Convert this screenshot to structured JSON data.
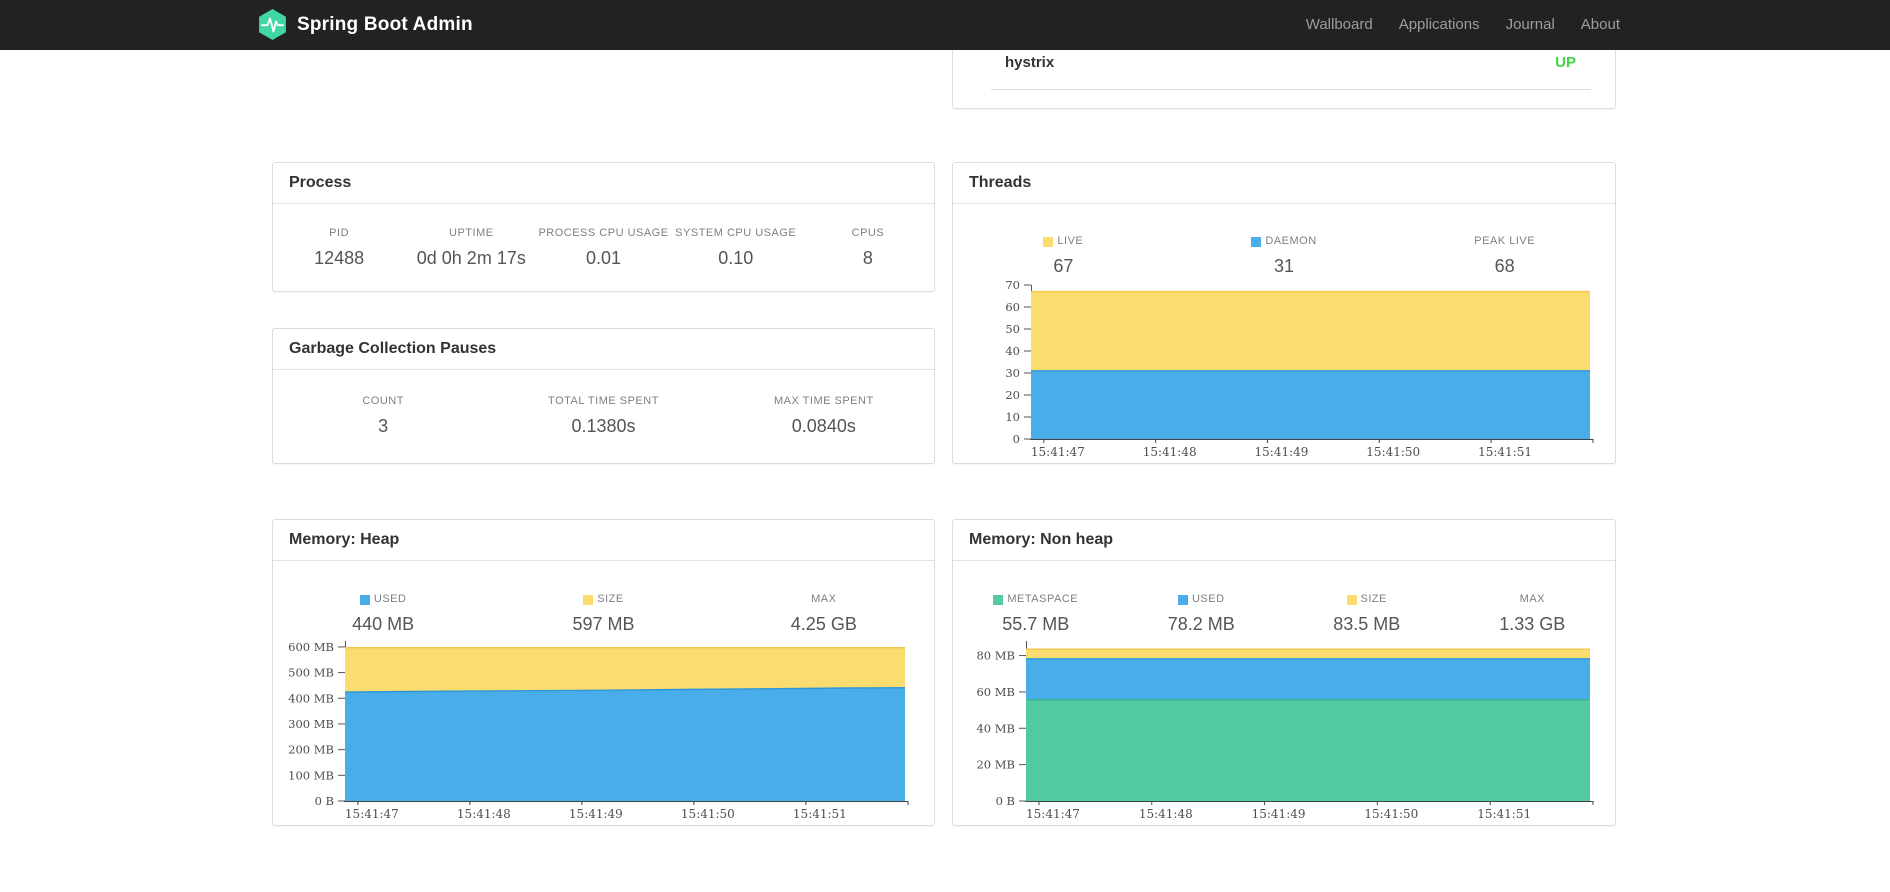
{
  "navbar": {
    "brand": "Spring Boot Admin",
    "links": [
      {
        "label": "Wallboard"
      },
      {
        "label": "Applications"
      },
      {
        "label": "Journal"
      },
      {
        "label": "About"
      }
    ]
  },
  "colors": {
    "navbar_bg": "#222222",
    "brand_logo_green": "#41d6a6",
    "status_up_green": "#41d543",
    "series_yellow": "#fbdd6f",
    "series_blue": "#49ade9",
    "series_green": "#52c9a3",
    "panel_border": "#dddddd"
  },
  "health": {
    "service": "hystrix",
    "status": "UP"
  },
  "panels": {
    "process": {
      "title": "Process",
      "stats": [
        {
          "label": "PID",
          "value": "12488"
        },
        {
          "label": "UPTIME",
          "value": "0d 0h 2m 17s"
        },
        {
          "label": "PROCESS CPU USAGE",
          "value": "0.01"
        },
        {
          "label": "SYSTEM CPU USAGE",
          "value": "0.10"
        },
        {
          "label": "CPUS",
          "value": "8"
        }
      ]
    },
    "gc": {
      "title": "Garbage Collection Pauses",
      "stats": [
        {
          "label": "COUNT",
          "value": "3"
        },
        {
          "label": "TOTAL TIME SPENT",
          "value": "0.1380s"
        },
        {
          "label": "MAX TIME SPENT",
          "value": "0.0840s"
        }
      ]
    },
    "threads": {
      "title": "Threads",
      "stats": [
        {
          "label": "LIVE",
          "value": "67",
          "swatch": "#fbdd6f"
        },
        {
          "label": "DAEMON",
          "value": "31",
          "swatch": "#49ade9"
        },
        {
          "label": "PEAK LIVE",
          "value": "68"
        }
      ]
    },
    "heap": {
      "title": "Memory: Heap",
      "stats": [
        {
          "label": "USED",
          "value": "440 MB",
          "swatch": "#49ade9"
        },
        {
          "label": "SIZE",
          "value": "597 MB",
          "swatch": "#fbdd6f"
        },
        {
          "label": "MAX",
          "value": "4.25 GB"
        }
      ]
    },
    "nonheap": {
      "title": "Memory: Non heap",
      "stats": [
        {
          "label": "METASPACE",
          "value": "55.7 MB",
          "swatch": "#52c9a3"
        },
        {
          "label": "USED",
          "value": "78.2 MB",
          "swatch": "#49ade9"
        },
        {
          "label": "SIZE",
          "value": "83.5 MB",
          "swatch": "#fbdd6f"
        },
        {
          "label": "MAX",
          "value": "1.33 GB"
        }
      ]
    }
  },
  "chart_data": [
    {
      "id": "threads",
      "type": "area",
      "title": "Threads",
      "ylim": [
        0,
        70
      ],
      "y_ticks": [
        {
          "v": 0,
          "label": "0"
        },
        {
          "v": 10,
          "label": "10"
        },
        {
          "v": 20,
          "label": "20"
        },
        {
          "v": 30,
          "label": "30"
        },
        {
          "v": 40,
          "label": "40"
        },
        {
          "v": 50,
          "label": "50"
        },
        {
          "v": 60,
          "label": "60"
        },
        {
          "v": 70,
          "label": "70"
        }
      ],
      "x_ticks": [
        {
          "frac": 0.023,
          "label": "15:41:47"
        },
        {
          "frac": 0.223,
          "label": "15:41:48"
        },
        {
          "frac": 0.423,
          "label": "15:41:49"
        },
        {
          "frac": 0.623,
          "label": "15:41:50"
        },
        {
          "frac": 0.823,
          "label": "15:41:51"
        }
      ],
      "areas": [
        {
          "name": "LIVE",
          "color": "#fbdd6f",
          "edge": "#edc84d",
          "points": [
            [
              0,
              67
            ],
            [
              1,
              67
            ]
          ]
        },
        {
          "name": "DAEMON",
          "color": "#49ade9",
          "edge": "#2b96d8",
          "points": [
            [
              0,
              31
            ],
            [
              1,
              31
            ]
          ]
        }
      ],
      "legend_position": "above",
      "grid": false
    },
    {
      "id": "heap",
      "type": "area",
      "title": "Memory: Heap",
      "ylim": [
        0,
        623
      ],
      "y_ticks": [
        {
          "v": 0,
          "label": "0 B"
        },
        {
          "v": 100,
          "label": "100 MB"
        },
        {
          "v": 200,
          "label": "200 MB"
        },
        {
          "v": 300,
          "label": "300 MB"
        },
        {
          "v": 400,
          "label": "400 MB"
        },
        {
          "v": 500,
          "label": "500 MB"
        },
        {
          "v": 600,
          "label": "600 MB"
        }
      ],
      "x_ticks": [
        {
          "frac": 0.023,
          "label": "15:41:47"
        },
        {
          "frac": 0.223,
          "label": "15:41:48"
        },
        {
          "frac": 0.423,
          "label": "15:41:49"
        },
        {
          "frac": 0.623,
          "label": "15:41:50"
        },
        {
          "frac": 0.823,
          "label": "15:41:51"
        }
      ],
      "areas": [
        {
          "name": "SIZE",
          "color": "#fbdd6f",
          "edge": "#edc84d",
          "points": [
            [
              0,
              597
            ],
            [
              1,
              597
            ]
          ]
        },
        {
          "name": "USED",
          "color": "#49ade9",
          "edge": "#2b96d8",
          "points": [
            [
              0,
              424
            ],
            [
              0.15,
              427
            ],
            [
              0.3,
              429
            ],
            [
              0.45,
              431
            ],
            [
              0.6,
              434
            ],
            [
              0.75,
              437
            ],
            [
              0.9,
              440
            ],
            [
              1,
              441
            ]
          ]
        }
      ],
      "legend_position": "above",
      "grid": false
    },
    {
      "id": "nonheap",
      "type": "area",
      "title": "Memory: Non heap",
      "ylim": [
        0,
        88
      ],
      "y_ticks": [
        {
          "v": 0,
          "label": "0 B"
        },
        {
          "v": 20,
          "label": "20 MB"
        },
        {
          "v": 40,
          "label": "40 MB"
        },
        {
          "v": 60,
          "label": "60 MB"
        },
        {
          "v": 80,
          "label": "80 MB"
        }
      ],
      "x_ticks": [
        {
          "frac": 0.023,
          "label": "15:41:47"
        },
        {
          "frac": 0.223,
          "label": "15:41:48"
        },
        {
          "frac": 0.423,
          "label": "15:41:49"
        },
        {
          "frac": 0.623,
          "label": "15:41:50"
        },
        {
          "frac": 0.823,
          "label": "15:41:51"
        }
      ],
      "areas": [
        {
          "name": "SIZE",
          "color": "#fbdd6f",
          "edge": "#edc84d",
          "points": [
            [
              0,
              83.5
            ],
            [
              1,
              83.5
            ]
          ]
        },
        {
          "name": "USED",
          "color": "#49ade9",
          "edge": "#2b96d8",
          "points": [
            [
              0,
              78.2
            ],
            [
              1,
              78.2
            ]
          ]
        },
        {
          "name": "METASPACE",
          "color": "#52c9a3",
          "edge": "#38b58c",
          "points": [
            [
              0,
              55.7
            ],
            [
              1,
              55.7
            ]
          ]
        }
      ],
      "legend_position": "above",
      "grid": false
    }
  ]
}
